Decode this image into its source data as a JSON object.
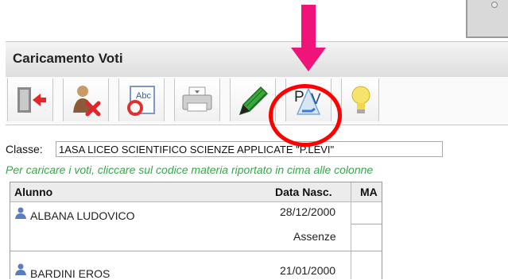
{
  "panel": {
    "title": "Caricamento Voti"
  },
  "toolbar": {
    "buttons": [
      {
        "name": "exit-button",
        "icon": "exit-door-icon"
      },
      {
        "name": "absence-button",
        "icon": "person-remove-icon"
      },
      {
        "name": "spelling-button",
        "icon": "abc-spellcheck-icon"
      },
      {
        "name": "print-button",
        "icon": "printer-icon"
      },
      {
        "name": "green-tool-button",
        "icon": "green-pen-icon"
      },
      {
        "name": "pv-button",
        "icon": "pv-icon",
        "label": "P V"
      },
      {
        "name": "tips-button",
        "icon": "lightbulb-icon"
      }
    ]
  },
  "class": {
    "label": "Classe:",
    "value": "1ASA LICEO SCIENTIFICO SCIENZE APPLICATE \"P.LEVI\""
  },
  "hint": "Per caricare i voti, cliccare sul codice materia riportato in cima alle colonne",
  "table": {
    "headers": [
      "Alunno",
      "Data Nasc.",
      "MA"
    ],
    "rows": [
      {
        "name": "ALBANA LUDOVICO",
        "birth": "28/12/2000",
        "note": "Assenze"
      },
      {
        "name": "BARDINI EROS",
        "birth": "21/01/2000"
      }
    ]
  },
  "annotation": {
    "arrow_color": "#f0147a",
    "circle_color": "#ff0000"
  }
}
